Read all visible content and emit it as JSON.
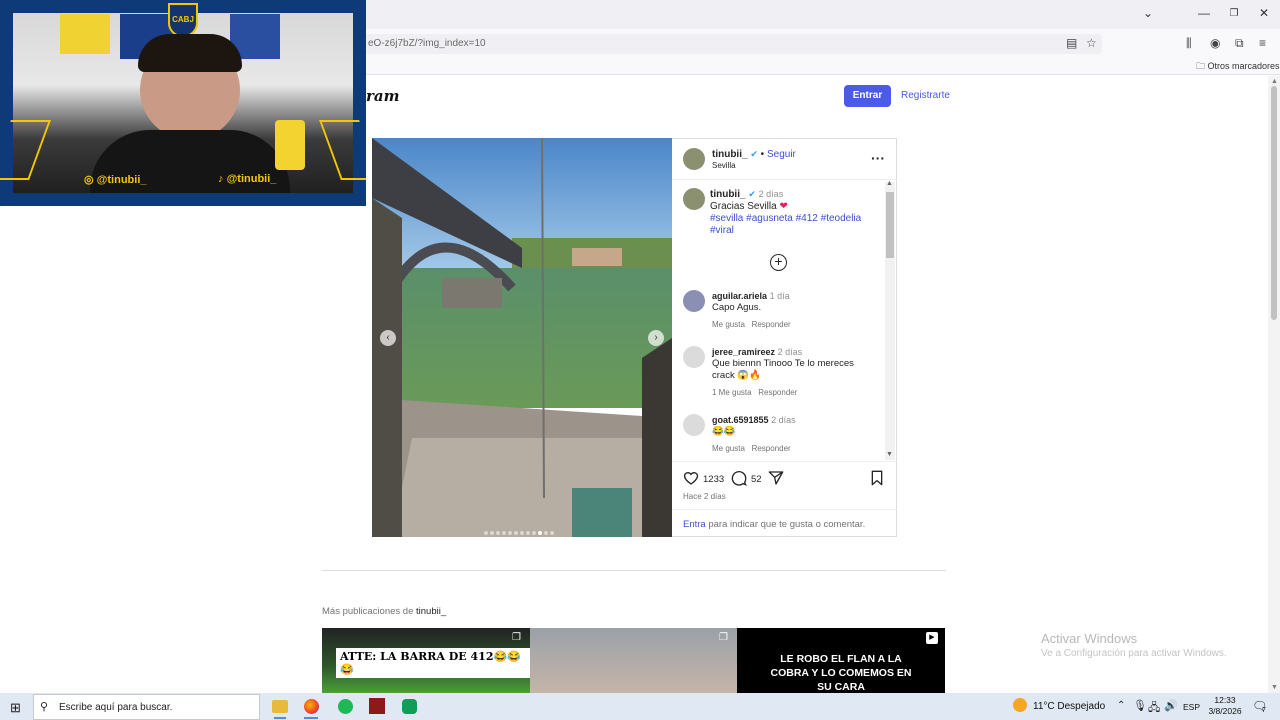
{
  "browser": {
    "url": "eO-z6j7bZ/?img_index=10",
    "bookmarks_other": "Otros marcadores"
  },
  "header": {
    "logo_fragment": "ram",
    "login_label": "Entrar",
    "register_label": "Registrarte"
  },
  "post": {
    "author": "tinubii_",
    "follow_label": "Seguir",
    "location": "Sevilla",
    "caption_author": "tinubii_",
    "caption_time": "2 días",
    "caption_text": "Gracias Sevilla",
    "hashtags_line1": "#sevilla #agusneta #412 #teodelia",
    "hashtags_line2": "#viral",
    "likes": "1233",
    "comments_count": "52",
    "time_ago": "Hace 2 días",
    "login_prompt_link": "Entra",
    "login_prompt_text": "para indicar que te gusta o comentar.",
    "carousel_dots": 12,
    "carousel_active": 10
  },
  "comments": [
    {
      "user": "aguilar.ariela",
      "time": "1 día",
      "text": "Capo Agus.",
      "likes": "Me gusta",
      "reply": "Responder"
    },
    {
      "user": "jeree_ramireez",
      "time": "2 días",
      "text": "Que biennn Tinooo Te lo mereces crack 😱🔥",
      "likes": "1 Me gusta",
      "reply": "Responder"
    },
    {
      "user": "goat.6591855",
      "time": "2 días",
      "text": "😂😂",
      "likes": "Me gusta",
      "reply": "Responder"
    }
  ],
  "more_posts": {
    "prefix": "Más publicaciones de",
    "user": "tinubii_",
    "thumb1_text": "ATTE: LA BARRA DE 412😂😂😂",
    "thumb3_text": "LE ROBO EL FLAN A LA COBRA Y LO COMEMOS EN SU CARA"
  },
  "webcam": {
    "handle1": "@tinubii_",
    "handle2": "@tinubii_",
    "badge": "CABJ"
  },
  "watermark": {
    "title": "Activar Windows",
    "subtitle": "Ve a Configuración para activar Windows."
  },
  "taskbar": {
    "search_placeholder": "Escribe aquí para buscar.",
    "weather": "11°C  Despejado",
    "language": "ESP",
    "time": "12:33",
    "date": "3/8/2026",
    "notifications": "7"
  }
}
